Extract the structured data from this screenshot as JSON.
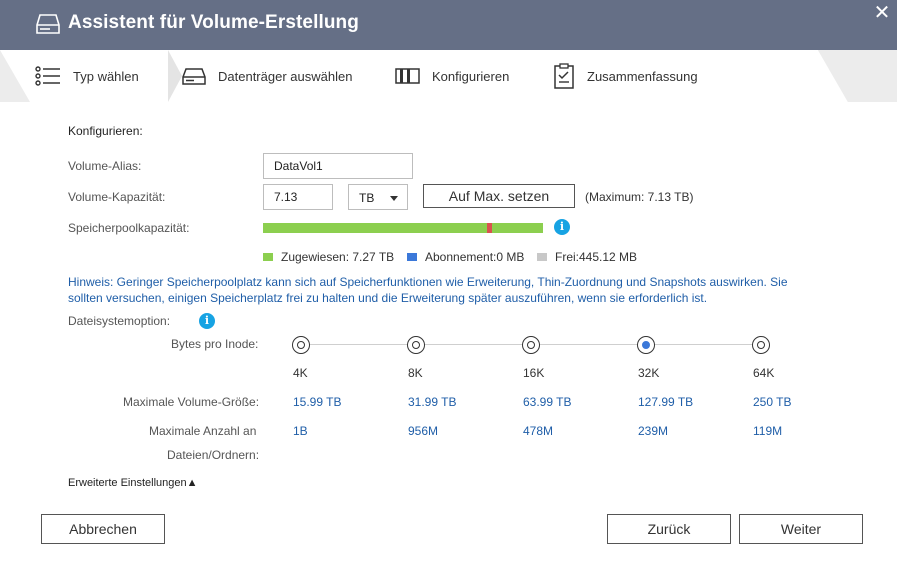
{
  "window": {
    "title": "Assistent für Volume-Erstellung"
  },
  "steps": [
    {
      "label": "Typ wählen"
    },
    {
      "label": "Datenträger auswählen"
    },
    {
      "label": "Konfigurieren"
    },
    {
      "label": "Zusammenfassung"
    }
  ],
  "form": {
    "section_title": "Konfigurieren:",
    "alias_label": "Volume-Alias:",
    "alias_value": "DataVol1",
    "capacity_label": "Volume-Kapazität:",
    "capacity_value": "7.13",
    "unit_value": "TB",
    "max_button": "Auf Max. setzen",
    "max_info": "(Maximum: 7.13 TB)",
    "pool_label": "Speicherpoolkapazität:",
    "pool_allocated_fraction": 0.8,
    "legend": [
      {
        "label": "Zugewiesen: 7.27 TB",
        "color": "#8ccf4f"
      },
      {
        "label": "Abonnement:0 MB",
        "color": "#3b78d9"
      },
      {
        "label": "Frei:445.12 MB",
        "color": "#c8c8c8"
      }
    ],
    "hint": "Hinweis: Geringer Speicherpoolplatz kann sich auf Speicherfunktionen wie Erweiterung, Thin-Zuordnung und Snapshots auswirken. Sie sollten versuchen, einigen Speicherplatz frei zu halten und die Erweiterung später auszuführen, wenn sie erforderlich ist.",
    "fs_label": "Dateisystemoption:",
    "inode_label": "Bytes pro Inode:",
    "max_size_label": "Maximale Volume-Größe:",
    "max_files_label_1": "Maximale Anzahl an",
    "max_files_label_2": "Dateien/Ordnern:",
    "options": [
      {
        "inode": "4K",
        "size": "15.99 TB",
        "files": "1B",
        "selected": false
      },
      {
        "inode": "8K",
        "size": "31.99 TB",
        "files": "956M",
        "selected": false
      },
      {
        "inode": "16K",
        "size": "63.99 TB",
        "files": "478M",
        "selected": false
      },
      {
        "inode": "32K",
        "size": "127.99 TB",
        "files": "239M",
        "selected": true
      },
      {
        "inode": "64K",
        "size": "250 TB",
        "files": "119M",
        "selected": false
      }
    ],
    "advanced": "Erweiterte Einstellungen▲"
  },
  "footer": {
    "cancel": "Abbrechen",
    "back": "Zurück",
    "next": "Weiter"
  },
  "icons": {
    "title": "drive-icon",
    "close": "close-icon",
    "info": "info-icon"
  }
}
